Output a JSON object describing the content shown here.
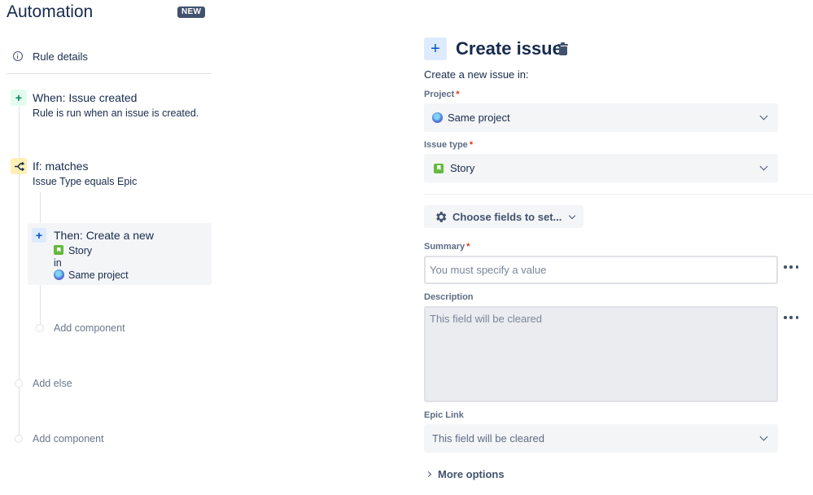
{
  "app": {
    "title": "Automation",
    "badge": "NEW"
  },
  "sidebar": {
    "rule_details": "Rule details",
    "trigger": {
      "title": "When: Issue created",
      "subtitle": "Rule is run when an issue is created."
    },
    "condition": {
      "title": "If: matches",
      "subtitle": "Issue Type equals Epic"
    },
    "action": {
      "title": "Then: Create a new",
      "issue_type": "Story",
      "connector": "in",
      "project": "Same project"
    },
    "add_component_inner": "Add component",
    "add_else": "Add else",
    "add_component_outer": "Add component"
  },
  "panel": {
    "title": "Create issue",
    "intro": "Create a new issue in:",
    "project": {
      "label": "Project",
      "required": "*",
      "value": "Same project"
    },
    "issue_type": {
      "label": "Issue type",
      "required": "*",
      "value": "Story"
    },
    "choose_fields": "Choose fields to set...",
    "summary": {
      "label": "Summary",
      "required": "*",
      "placeholder": "You must specify a value"
    },
    "description": {
      "label": "Description",
      "placeholder": "This field will be cleared"
    },
    "epic_link": {
      "label": "Epic Link",
      "value": "This field will be cleared"
    },
    "more_options": "More options"
  },
  "colors": {
    "accent_blue": "#0052cc",
    "story_green": "#63ba3c",
    "required_red": "#de350b",
    "text": "#172b4d"
  },
  "icons": [
    "info-icon",
    "plus-icon",
    "branch-icon",
    "story-icon",
    "project-icon",
    "trash-icon",
    "gear-icon",
    "chevron-down-icon",
    "more-icon",
    "chevron-right-icon"
  ]
}
